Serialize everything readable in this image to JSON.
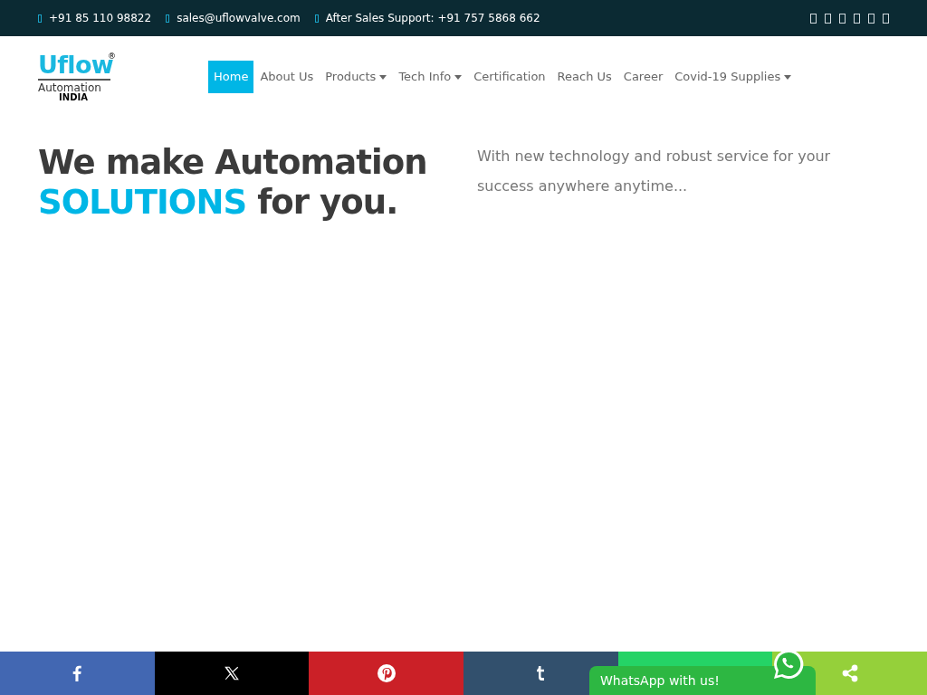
{
  "topbar": {
    "contacts": [
      "+91 85 110 98822",
      "sales@uflowvalve.com",
      "After Sales Support: +91 757 5868 662"
    ]
  },
  "logo": {
    "brand": "Uflow",
    "registered": "®",
    "line1": "Automation",
    "line2": "INDIA"
  },
  "nav": [
    {
      "label": "Home",
      "selected": true,
      "dropdown": false
    },
    {
      "label": "About Us",
      "selected": false,
      "dropdown": false
    },
    {
      "label": "Products",
      "selected": false,
      "dropdown": true
    },
    {
      "label": "Tech Info",
      "selected": false,
      "dropdown": true
    },
    {
      "label": "Certification",
      "selected": false,
      "dropdown": false
    },
    {
      "label": "Reach Us",
      "selected": false,
      "dropdown": false
    },
    {
      "label": "Career",
      "selected": false,
      "dropdown": false
    },
    {
      "label": "Covid-19 Supplies",
      "selected": false,
      "dropdown": true
    }
  ],
  "hero": {
    "line1": "We make Automation",
    "highlight": "SOLUTIONS",
    "rest": "for you.",
    "tagline": "With new technology and robust service for your success anywhere anytime..."
  },
  "share_bar": [
    {
      "kind": "facebook",
      "color": "#4267b2"
    },
    {
      "kind": "x",
      "color": "#000000"
    },
    {
      "kind": "pinterest",
      "color": "#cb2027"
    },
    {
      "kind": "tumblr",
      "color": "#32506d"
    },
    {
      "kind": "whatsapp",
      "color": "#25d366"
    },
    {
      "kind": "share",
      "color": "#95d03a"
    }
  ],
  "whatsapp_chat": {
    "label": "WhatsApp with us!"
  }
}
